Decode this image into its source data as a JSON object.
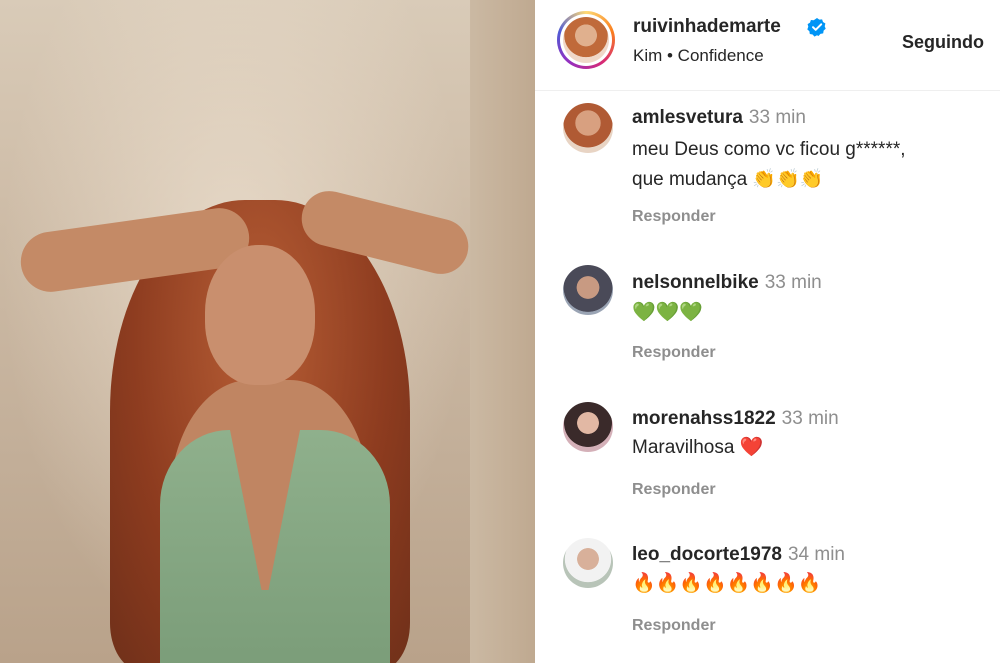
{
  "post": {
    "username": "ruivinhademarte",
    "audio": "Kim • Confidence",
    "follow_label": "Seguindo"
  },
  "comments": [
    {
      "user": "amlesvetura",
      "time": "33 min",
      "text_lines": [
        "meu Deus como vc ficou g******,",
        "que mudança 👏👏👏"
      ],
      "reply": "Responder"
    },
    {
      "user": "nelsonnelbike",
      "time": "33 min",
      "text_lines": [
        "💚💚💚"
      ],
      "reply": "Responder"
    },
    {
      "user": "morenahss1822",
      "time": "33 min",
      "text_lines": [
        "Maravilhosa ❤️"
      ],
      "reply": "Responder"
    },
    {
      "user": "leo_docorte1978",
      "time": "34 min",
      "text_lines": [
        "🔥🔥🔥🔥🔥🔥🔥🔥"
      ],
      "reply": "Responder"
    }
  ],
  "colors": {
    "verified": "#0095f6",
    "muted": "#8e8e8e",
    "text": "#262626"
  }
}
